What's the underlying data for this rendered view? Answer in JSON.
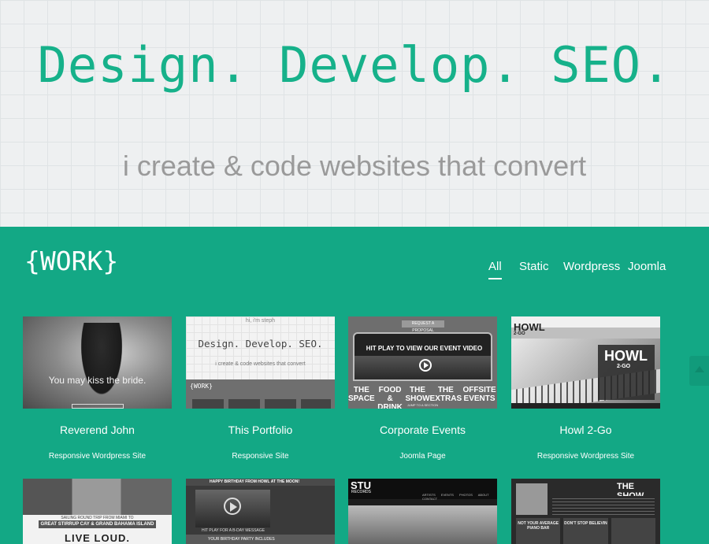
{
  "hero": {
    "title": "Design. Develop. SEO.",
    "subtitle": "i create & code websites that convert"
  },
  "work": {
    "logo": "{WORK}",
    "filters": [
      "All",
      "Static",
      "Wordpress",
      "Joomla"
    ],
    "active_filter": "All",
    "projects": [
      {
        "title": "Reverend John",
        "type": "Responsive Wordpress Site",
        "thumb_text": "You may kiss the bride."
      },
      {
        "title": "This Portfolio",
        "type": "Responsive Site",
        "thumb_hi": "hi, i'm steph",
        "thumb_title": "Design. Develop. SEO.",
        "thumb_sub": "i create & code websites that convert",
        "thumb_logo": "{WORK}"
      },
      {
        "title": "Corporate Events",
        "type": "Joomla Page",
        "thumb_request": "REQUEST A PROPOSAL",
        "thumb_video": "HIT PLAY TO VIEW OUR EVENT VIDEO",
        "thumb_menu": [
          "THE SPACE",
          "FOOD & DRINK",
          "THE SHOW",
          "THE EXTRAS",
          "OFFSITE EVENTS"
        ],
        "thumb_jump": "JUMP TO A SECTION"
      },
      {
        "title": "Howl 2-Go",
        "type": "Responsive Wordpress Site",
        "thumb_logo": "HOWL",
        "thumb_logo_sub": "2-GO"
      },
      {
        "thumb_line": "SAILING ROUND TRIP FROM MIAMI TO",
        "thumb_band": "GREAT STIRRUP CAY & GRAND BAHAMA ISLAND",
        "thumb_big": "LIVE LOUD."
      },
      {
        "thumb_header": "HAPPY BIRTHDAY FROM HOWL AT THE MOON!",
        "thumb_caption": "HIT PLAY FOR A B-DAY MESSAGE",
        "thumb_bar": "YOUR BIRTHDAY PARTY INCLUDES"
      },
      {
        "thumb_logo": "STU",
        "thumb_logo_sub": "RECORDS",
        "thumb_nav": "ARTISTS EVENTS PHOTOS ABOUT CONTACT"
      },
      {
        "thumb_title": "THE SHOW",
        "thumb_tiles": [
          "NOT YOUR AVERAGE PIANO BAR",
          "DON'T STOP BELIEVIN",
          ""
        ]
      }
    ]
  },
  "colors": {
    "accent": "#16b18a",
    "section_bg": "#13a885"
  }
}
